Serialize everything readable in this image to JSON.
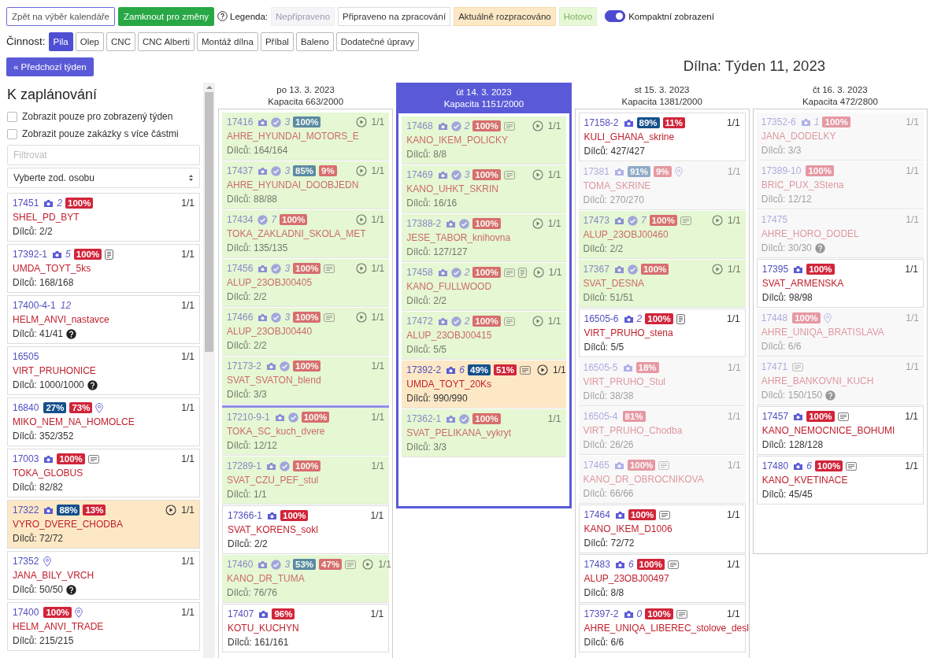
{
  "toolbar": {
    "buttons": [
      {
        "label": "Zpět na výběr kalendáře",
        "kind": "outline"
      },
      {
        "label": "Zamknout pro změny",
        "kind": "success"
      }
    ]
  },
  "legend": {
    "label": "Legenda:",
    "items": [
      {
        "label": "Nepřipraveno",
        "kind": "not_ready"
      },
      {
        "label": "Připraveno na zpracování",
        "kind": "ready"
      },
      {
        "label": "Aktuálně rozpracováno",
        "kind": "in_progress"
      },
      {
        "label": "Hotovo",
        "kind": "done"
      }
    ]
  },
  "compact": {
    "label": "Kompaktní zobrazení",
    "on": true
  },
  "activity": {
    "label": "Činnost:",
    "tabs": [
      {
        "label": "Pila",
        "selected": true
      },
      {
        "label": "Olep",
        "selected": false
      },
      {
        "label": "CNC",
        "selected": false
      },
      {
        "label": "CNC Alberti",
        "selected": false
      },
      {
        "label": "Montáž dílna",
        "selected": false
      },
      {
        "label": "Příbal",
        "selected": false
      },
      {
        "label": "Baleno",
        "selected": false
      },
      {
        "label": "Dodatečné úpravy",
        "selected": false
      }
    ]
  },
  "prev_week": "« Předchozí týden",
  "title": "Dílna: Týden 11, 2023",
  "left": {
    "title": "K zaplánování",
    "filters": [
      {
        "label": "Zobrazit pouze pro zobrazený týden",
        "checked": false
      },
      {
        "label": "Zobrazit pouze zakázky s více částmi",
        "checked": false
      }
    ],
    "search": {
      "placeholder": "Filtrovat"
    },
    "person_select": "Vyberte zod. osobu",
    "cards": [
      {
        "id": "17451",
        "camera": true,
        "count": "2",
        "badges": [
          {
            "text": "100%",
            "kind": "remaining"
          }
        ],
        "qty": "1/1",
        "name": "SHEL_PD_BYT",
        "parts": "Dílců: 2/2",
        "kind": "ready"
      },
      {
        "id": "17392-1",
        "camera": true,
        "count": "5",
        "badges": [
          {
            "text": "100%",
            "kind": "remaining"
          }
        ],
        "doc": true,
        "qty": "1/1",
        "name": "UMDA_TOYT_5ks",
        "parts": "Dílců: 168/168",
        "kind": "ready"
      },
      {
        "id": "17400-4-1",
        "count": "12",
        "qty": "1/1",
        "name": "HELM_ANVI_nastavce",
        "parts": "Dílců: 41/41",
        "help": true,
        "kind": "ready"
      },
      {
        "id": "16505",
        "qty": "1/1",
        "name": "VIRT_PRUHONICE",
        "parts": "Dílců: 1000/1000",
        "help": true,
        "kind": "ready"
      },
      {
        "id": "16840",
        "badges": [
          {
            "text": "27%",
            "kind": "done"
          },
          {
            "text": "73%",
            "kind": "remaining"
          }
        ],
        "pin": true,
        "qty": "1/1",
        "name": "MIKO_NEM_NA_HOMOLCE",
        "parts": "Dílců: 352/352",
        "kind": "ready"
      },
      {
        "id": "17003",
        "camera": true,
        "badges": [
          {
            "text": "100%",
            "kind": "remaining"
          }
        ],
        "note": true,
        "qty": "1/1",
        "name": "TOKA_GLOBUS",
        "parts": "Dílců: 82/82",
        "kind": "ready"
      },
      {
        "id": "17322",
        "camera": true,
        "badges": [
          {
            "text": "88%",
            "kind": "done"
          },
          {
            "text": "13%",
            "kind": "remaining"
          }
        ],
        "play": true,
        "qty": "1/1",
        "name": "VYRO_DVERE_CHODBA",
        "parts": "Dílců: 72/72",
        "kind": "in_progress"
      },
      {
        "id": "17352",
        "pin": true,
        "qty": "1/1",
        "name": "JANA_BILY_VRCH",
        "parts": "Dílců: 50/50",
        "help": true,
        "kind": "ready"
      },
      {
        "id": "17400",
        "badges": [
          {
            "text": "100%",
            "kind": "remaining"
          }
        ],
        "pin": true,
        "qty": "1/1",
        "name": "HELM_ANVI_TRADE",
        "parts": "Dílců: 215/215",
        "kind": "ready"
      }
    ]
  },
  "days": [
    {
      "date": "po 13. 3. 2023",
      "capacity": "Kapacita 663/2000",
      "selected": false,
      "cards": [
        {
          "id": "17416",
          "camera": true,
          "check": true,
          "count": "3",
          "badges": [
            {
              "text": "100%",
              "kind": "done"
            }
          ],
          "play": true,
          "qty": "1/1",
          "name": "AHRE_HYUNDAI_MOTORS_E",
          "parts": "Dílců: 164/164",
          "kind": "done"
        },
        {
          "id": "17437",
          "camera": true,
          "check": true,
          "count": "3",
          "badges": [
            {
              "text": "85%",
              "kind": "done"
            },
            {
              "text": "9%",
              "kind": "remaining"
            }
          ],
          "play": true,
          "qty": "1/1",
          "name": "AHRE_HYUNDAI_DOOBJEDN",
          "parts": "Dílců: 88/88",
          "kind": "done"
        },
        {
          "id": "17434",
          "check": true,
          "count": "7",
          "badges": [
            {
              "text": "100%",
              "kind": "remaining"
            }
          ],
          "play": true,
          "qty": "1/1",
          "name": "TOKA_ZAKLADNI_SKOLA_MET",
          "parts": "Dílců: 135/135",
          "kind": "done"
        },
        {
          "id": "17456",
          "camera": true,
          "check": true,
          "count": "3",
          "badges": [
            {
              "text": "100%",
              "kind": "remaining"
            }
          ],
          "note": true,
          "play": true,
          "qty": "1/1",
          "name": "ALUP_23OBJ00405",
          "parts": "Dílců: 2/2",
          "kind": "done"
        },
        {
          "id": "17466",
          "camera": true,
          "check": true,
          "count": "3",
          "badges": [
            {
              "text": "100%",
              "kind": "remaining"
            }
          ],
          "note": true,
          "play": true,
          "qty": "1/1",
          "name": "ALUP_23OBJ00440",
          "parts": "Dílců: 2/2",
          "kind": "done"
        },
        {
          "id": "17173-2",
          "camera": true,
          "check": true,
          "badges": [
            {
              "text": "100%",
              "kind": "remaining"
            }
          ],
          "qty": "1/1",
          "name": "SVAT_SVATON_blend",
          "parts": "Dílců: 3/3",
          "kind": "done"
        },
        {
          "id": "17210-9-1",
          "camera": true,
          "check": true,
          "badges": [
            {
              "text": "100%",
              "kind": "remaining"
            }
          ],
          "qty": "1/1",
          "name": "TOKA_SC_kuch_dvere",
          "parts": "Dílců: 12/12",
          "kind": "done",
          "line_before": true
        },
        {
          "id": "17289-1",
          "camera": true,
          "check": true,
          "badges": [
            {
              "text": "100%",
              "kind": "remaining"
            }
          ],
          "qty": "1/1",
          "name": "SVAT_CZU_PEF_stul",
          "parts": "Dílců: 1/1",
          "kind": "done"
        },
        {
          "id": "17366-1",
          "camera": true,
          "badges": [
            {
              "text": "100%",
              "kind": "remaining"
            }
          ],
          "qty": "1/1",
          "name": "SVAT_KORENS_sokl",
          "parts": "Dílců: 2/2",
          "kind": "ready"
        },
        {
          "id": "17460",
          "camera": true,
          "check": true,
          "count": "3",
          "badges": [
            {
              "text": "53%",
              "kind": "done"
            },
            {
              "text": "47%",
              "kind": "remaining"
            }
          ],
          "note": true,
          "play": true,
          "qty": "1/1",
          "name": "KANO_DR_TUMA",
          "parts": "Dílců: 76/76",
          "kind": "done"
        },
        {
          "id": "17407",
          "camera": true,
          "badges": [
            {
              "text": "96%",
              "kind": "remaining"
            }
          ],
          "qty": "1/1",
          "name": "KOTU_KUCHYN",
          "parts": "Dílců: 161/161",
          "kind": "ready"
        }
      ]
    },
    {
      "date": "út 14. 3. 2023",
      "capacity": "Kapacita 1151/2000",
      "selected": true,
      "cards": [
        {
          "id": "17468",
          "camera": true,
          "check": true,
          "count": "2",
          "badges": [
            {
              "text": "100%",
              "kind": "remaining"
            }
          ],
          "note": true,
          "play": true,
          "qty": "1/1",
          "name": "KANO_IKEM_POLICKY",
          "parts": "Dílců: 8/8",
          "kind": "done"
        },
        {
          "id": "17469",
          "camera": true,
          "check": true,
          "count": "3",
          "badges": [
            {
              "text": "100%",
              "kind": "remaining"
            }
          ],
          "note": true,
          "play": true,
          "qty": "1/1",
          "name": "KANO_UHKT_SKRIN",
          "parts": "Dílců: 16/16",
          "kind": "done"
        },
        {
          "id": "17388-2",
          "camera": true,
          "check": true,
          "badges": [
            {
              "text": "100%",
              "kind": "remaining"
            }
          ],
          "play": true,
          "qty": "1/1",
          "name": "JESE_TABOR_knihovna",
          "parts": "Dílců: 127/127",
          "kind": "done"
        },
        {
          "id": "17458",
          "camera": true,
          "check": true,
          "count": "2",
          "badges": [
            {
              "text": "100%",
              "kind": "remaining"
            }
          ],
          "note": true,
          "doc": true,
          "play": true,
          "qty": "1/1",
          "name": "KANO_FULLWOOD",
          "parts": "Dílců: 2/2",
          "kind": "done"
        },
        {
          "id": "17472",
          "camera": true,
          "check": true,
          "count": "2",
          "badges": [
            {
              "text": "100%",
              "kind": "remaining"
            }
          ],
          "note": true,
          "play": true,
          "qty": "1/1",
          "name": "ALUP_23OBJ00415",
          "parts": "Dílců: 5/5",
          "kind": "done"
        },
        {
          "id": "17392-2",
          "camera": true,
          "count": "6",
          "badges": [
            {
              "text": "49%",
              "kind": "done"
            },
            {
              "text": "51%",
              "kind": "remaining"
            }
          ],
          "note": true,
          "play": true,
          "qty": "1/1",
          "name": "UMDA_TOYT_20Ks",
          "parts": "Dílců: 990/990",
          "kind": "in_progress"
        },
        {
          "id": "17362-1",
          "camera": true,
          "check": true,
          "badges": [
            {
              "text": "100%",
              "kind": "remaining"
            }
          ],
          "qty": "1/1",
          "name": "SVAT_PELIKANA_vykryt",
          "parts": "Dílců: 3/3",
          "kind": "done"
        }
      ]
    },
    {
      "date": "st 15. 3. 2023",
      "capacity": "Kapacita 1381/2000",
      "selected": false,
      "cards": [
        {
          "id": "17158-2",
          "camera": true,
          "badges": [
            {
              "text": "89%",
              "kind": "done"
            },
            {
              "text": "11%",
              "kind": "remaining"
            }
          ],
          "qty": "1/1",
          "name": "KULI_GHANA_skrine",
          "parts": "Dílců: 427/427",
          "kind": "ready"
        },
        {
          "id": "17381",
          "camera": true,
          "badges": [
            {
              "text": "91%",
              "kind": "done"
            },
            {
              "text": "9%",
              "kind": "remaining"
            }
          ],
          "pin": true,
          "qty": "1/1",
          "name": "TOMA_SKRINE",
          "parts": "Dílců: 270/270",
          "kind": "not_ready"
        },
        {
          "id": "17473",
          "camera": true,
          "check": true,
          "count": "7",
          "badges": [
            {
              "text": "100%",
              "kind": "remaining"
            }
          ],
          "note": true,
          "play": true,
          "qty": "1/1",
          "name": "ALUP_23OBJ00460",
          "parts": "Dílců: 2/2",
          "kind": "done"
        },
        {
          "id": "17367",
          "camera": true,
          "check": true,
          "badges": [
            {
              "text": "100%",
              "kind": "remaining"
            }
          ],
          "play": true,
          "qty": "1/1",
          "name": "SVAT_DESNA",
          "parts": "Dílců: 51/51",
          "kind": "done"
        },
        {
          "id": "16505-6",
          "camera": true,
          "count": "2",
          "badges": [
            {
              "text": "100%",
              "kind": "remaining"
            }
          ],
          "doc": true,
          "qty": "1/1",
          "name": "VIRT_PRUHO_stena",
          "parts": "Dílců: 5/5",
          "kind": "ready"
        },
        {
          "id": "16505-5",
          "camera": true,
          "badges": [
            {
              "text": "18%",
              "kind": "remaining"
            }
          ],
          "qty": "1/1",
          "name": "VIRT_PRUHO_Stul",
          "parts": "Dílců: 38/38",
          "kind": "not_ready"
        },
        {
          "id": "16505-4",
          "badges": [
            {
              "text": "81%",
              "kind": "remaining"
            }
          ],
          "qty": "1/1",
          "name": "VIRT_PRUHO_Chodba",
          "parts": "Dílců: 26/26",
          "kind": "not_ready"
        },
        {
          "id": "17465",
          "camera": true,
          "badges": [
            {
              "text": "100%",
              "kind": "remaining"
            }
          ],
          "note": true,
          "qty": "1/1",
          "name": "KANO_DR_OBROCNIKOVA",
          "parts": "Dílců: 66/66",
          "kind": "not_ready"
        },
        {
          "id": "17464",
          "camera": true,
          "badges": [
            {
              "text": "100%",
              "kind": "remaining"
            }
          ],
          "note": true,
          "qty": "1/1",
          "name": "KANO_IKEM_D1006",
          "parts": "Dílců: 72/72",
          "kind": "ready"
        },
        {
          "id": "17483",
          "camera": true,
          "count": "6",
          "badges": [
            {
              "text": "100%",
              "kind": "remaining"
            }
          ],
          "note": true,
          "qty": "1/1",
          "name": "ALUP_23OBJ00497",
          "parts": "Dílců: 8/8",
          "kind": "ready"
        },
        {
          "id": "17397-2",
          "camera": true,
          "count": "0",
          "badges": [
            {
              "text": "100%",
              "kind": "remaining"
            }
          ],
          "note": true,
          "qty": "1/1",
          "name": "AHRE_UNIQA_LIBEREC_stolove_desl",
          "parts": "Dílců: 6/6",
          "kind": "ready"
        }
      ]
    },
    {
      "date": "čt 16. 3. 2023",
      "capacity": "Kapacita 472/2800",
      "selected": false,
      "cards": [
        {
          "id": "17352-6",
          "camera": true,
          "count": "1",
          "badges": [
            {
              "text": "100%",
              "kind": "remaining"
            }
          ],
          "qty": "1/1",
          "name": "JANA_DODELKY",
          "parts": "Dílců: 3/3",
          "kind": "not_ready"
        },
        {
          "id": "17389-10",
          "badges": [
            {
              "text": "100%",
              "kind": "remaining"
            }
          ],
          "qty": "1/1",
          "name": "BRIC_PUX_3Stena",
          "parts": "Dílců: 12/12",
          "kind": "not_ready"
        },
        {
          "id": "17475",
          "qty": "1/1",
          "name": "AHRE_HORO_DODEL",
          "parts": "Dílců: 30/30",
          "help": true,
          "kind": "not_ready"
        },
        {
          "id": "17395",
          "camera": true,
          "badges": [
            {
              "text": "100%",
              "kind": "remaining"
            }
          ],
          "qty": "1/1",
          "name": "SVAT_ARMENSKA",
          "parts": "Dílců: 98/98",
          "kind": "ready"
        },
        {
          "id": "17448",
          "badges": [
            {
              "text": "100%",
              "kind": "remaining"
            }
          ],
          "pin": true,
          "qty": "1/1",
          "name": "AHRE_UNIQA_BRATISLAVA",
          "parts": "Dílců: 6/6",
          "kind": "not_ready"
        },
        {
          "id": "17471",
          "note": true,
          "qty": "1/1",
          "name": "AHRE_BANKOVNI_KUCH",
          "parts": "Dílců: 150/150",
          "help": true,
          "kind": "not_ready"
        },
        {
          "id": "17457",
          "camera": true,
          "badges": [
            {
              "text": "100%",
              "kind": "remaining"
            }
          ],
          "note": true,
          "qty": "1/1",
          "name": "KANO_NEMOCNICE_BOHUMI",
          "parts": "Dílců: 128/128",
          "kind": "ready"
        },
        {
          "id": "17480",
          "camera": true,
          "count": "6",
          "badges": [
            {
              "text": "100%",
              "kind": "remaining"
            }
          ],
          "note": true,
          "qty": "1/1",
          "name": "KANO_KVETINACE",
          "parts": "Dílců: 45/45",
          "kind": "ready"
        }
      ]
    }
  ]
}
